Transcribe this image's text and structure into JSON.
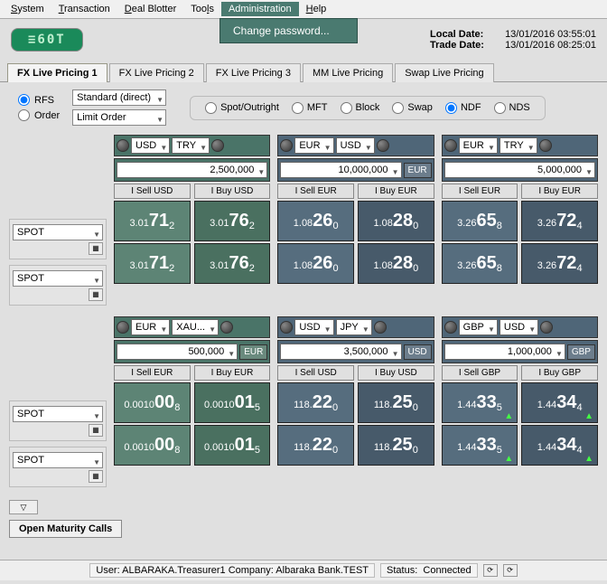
{
  "menu": {
    "items": [
      "System",
      "Transaction",
      "Deal Blotter",
      "Tools",
      "Administration",
      "Help"
    ],
    "active": "Administration",
    "dropdown": [
      "Change password..."
    ]
  },
  "header": {
    "logo": "≡60T",
    "local_date_label": "Local Date:",
    "local_date": "13/01/2016 03:55:01",
    "trade_date_label": "Trade Date:",
    "trade_date": "13/01/2016 08:25:01"
  },
  "tabs": [
    "FX Live Pricing 1",
    "FX Live Pricing 2",
    "FX Live Pricing 3",
    "MM Live Pricing",
    "Swap Live Pricing"
  ],
  "active_tab": "FX Live Pricing 1",
  "mode": {
    "rfs_label": "RFS",
    "order_label": "Order",
    "rfs_select": "Standard (direct)",
    "order_select": "Limit Order"
  },
  "products": [
    "Spot/Outright",
    "MFT",
    "Block",
    "Swap",
    "NDF",
    "NDS"
  ],
  "product_selected": "NDF",
  "side_label": "SPOT",
  "sell_prefix": "I Sell ",
  "buy_prefix": "I Buy ",
  "tiles": [
    {
      "theme": "green",
      "ccy1": "USD",
      "ccy2": "TRY",
      "amount": "2,500,000",
      "amt_ccy": "",
      "sell": {
        "pre": "3.01",
        "big": "71",
        "sub": "2"
      },
      "buy": {
        "pre": "3.01",
        "big": "76",
        "sub": "2"
      }
    },
    {
      "theme": "blue",
      "ccy1": "EUR",
      "ccy2": "USD",
      "amount": "10,000,000",
      "amt_ccy": "EUR",
      "sell": {
        "pre": "1.08",
        "big": "26",
        "sub": "0"
      },
      "buy": {
        "pre": "1.08",
        "big": "28",
        "sub": "0"
      }
    },
    {
      "theme": "blue",
      "ccy1": "EUR",
      "ccy2": "TRY",
      "amount": "5,000,000",
      "amt_ccy": "",
      "sell": {
        "pre": "3.26",
        "big": "65",
        "sub": "8"
      },
      "buy": {
        "pre": "3.26",
        "big": "72",
        "sub": "4"
      }
    },
    {
      "theme": "green",
      "ccy1": "EUR",
      "ccy2": "XAU...",
      "amount": "500,000",
      "amt_ccy": "EUR",
      "sell": {
        "pre": "0.0010",
        "big": "00",
        "sub": "8"
      },
      "buy": {
        "pre": "0.0010",
        "big": "01",
        "sub": "5"
      }
    },
    {
      "theme": "blue",
      "ccy1": "USD",
      "ccy2": "JPY",
      "amount": "3,500,000",
      "amt_ccy": "USD",
      "sell": {
        "pre": "118.",
        "big": "22",
        "sub": "0"
      },
      "buy": {
        "pre": "118.",
        "big": "25",
        "sub": "0"
      }
    },
    {
      "theme": "blue",
      "ccy1": "GBP",
      "ccy2": "USD",
      "amount": "1,000,000",
      "amt_ccy": "GBP",
      "sell": {
        "pre": "1.44",
        "big": "33",
        "sub": "5"
      },
      "buy": {
        "pre": "1.44",
        "big": "34",
        "sub": "4"
      },
      "arrow": true
    }
  ],
  "open_maturity": "Open Maturity Calls",
  "status": {
    "user_label": "User:",
    "user": "ALBARAKA.Treasurer1",
    "company_label": "Company:",
    "company": "Albaraka Bank.TEST",
    "status_label": "Status:",
    "status": "Connected"
  }
}
